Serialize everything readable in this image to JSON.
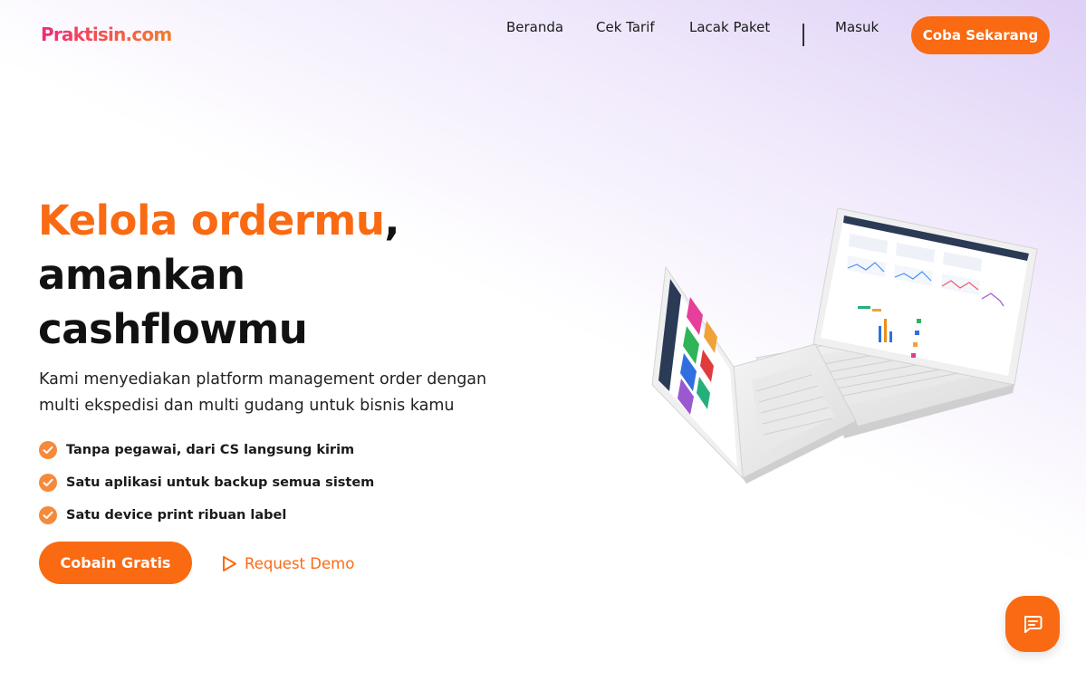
{
  "header": {
    "logo_text": "Praktisin.com",
    "nav": [
      "Beranda",
      "Cek Tarif",
      "Lacak Paket",
      "Masuk"
    ],
    "cta": "Coba Sekarang"
  },
  "hero": {
    "title_accent": "Kelola ordermu",
    "title_comma": ",",
    "title_line2": "amankan",
    "title_line3": "cashflowmu",
    "subtitle": "Kami menyediakan platform management order dengan multi ekspedisi dan multi gudang untuk bisnis kamu",
    "features": [
      "Tanpa pegawai, dari CS langsung kirim",
      "Satu aplikasi untuk backup semua sistem",
      "Satu device print ribuan label"
    ],
    "primary_button": "Cobain Gratis",
    "demo_button": "Request Demo"
  },
  "colors": {
    "accent": "#f96a13",
    "check": "#f58a3c",
    "gradient_tint": "#dccdf5"
  },
  "icons": {
    "check": "check-circle-icon",
    "play": "play-outline-icon",
    "chat": "chat-bubble-icon"
  }
}
